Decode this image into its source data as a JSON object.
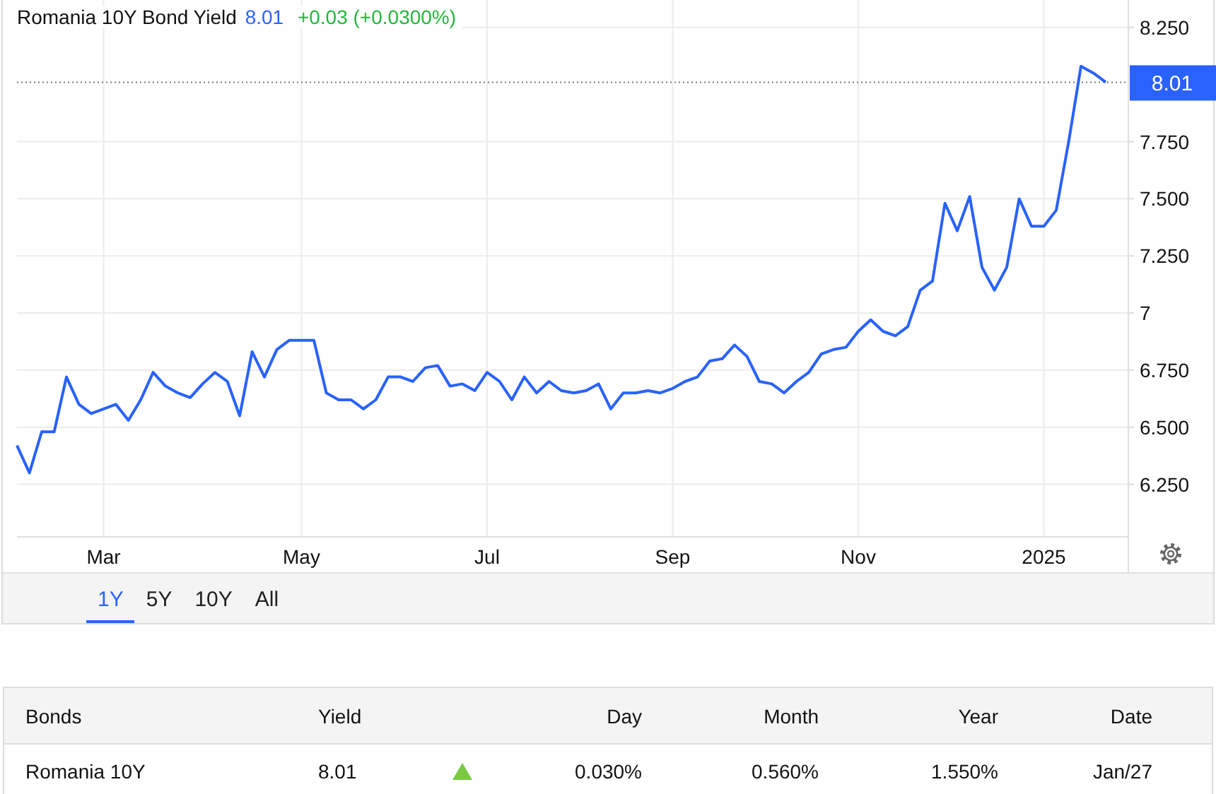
{
  "header": {
    "price": "8.01",
    "change": "+0.03 (+0.0300%)"
  },
  "chart": {
    "chart_data": {
      "type": "line",
      "categories": [
        null,
        null,
        null,
        null,
        null,
        null,
        null,
        "Mar",
        null,
        null,
        null,
        null,
        null,
        null,
        null,
        null,
        null,
        null,
        null,
        null,
        null,
        null,
        null,
        "May",
        null,
        null,
        null,
        null,
        null,
        null,
        null,
        null,
        null,
        null,
        null,
        null,
        null,
        null,
        "Jul",
        null,
        null,
        null,
        null,
        null,
        null,
        null,
        null,
        null,
        null,
        null,
        null,
        null,
        null,
        "Sep",
        null,
        null,
        null,
        null,
        null,
        null,
        null,
        null,
        null,
        null,
        null,
        null,
        null,
        null,
        "Nov",
        null,
        null,
        null,
        null,
        null,
        null,
        null,
        null,
        null,
        null,
        null,
        null,
        null,
        null,
        "2025",
        null,
        null,
        null,
        null,
        null
      ],
      "series": [
        {
          "name": "Romania 10Y Bond Yield",
          "color": "#2962ff",
          "values": [
            6.42,
            6.3,
            6.48,
            6.48,
            6.72,
            6.6,
            6.56,
            6.58,
            6.6,
            6.53,
            6.62,
            6.74,
            6.68,
            6.65,
            6.63,
            6.69,
            6.74,
            6.7,
            6.55,
            6.83,
            6.72,
            6.84,
            6.88,
            6.88,
            6.88,
            6.65,
            6.62,
            6.62,
            6.58,
            6.62,
            6.72,
            6.72,
            6.7,
            6.76,
            6.77,
            6.68,
            6.69,
            6.66,
            6.74,
            6.7,
            6.62,
            6.72,
            6.65,
            6.7,
            6.66,
            6.65,
            6.66,
            6.69,
            6.58,
            6.65,
            6.65,
            6.66,
            6.65,
            6.67,
            6.7,
            6.72,
            6.79,
            6.8,
            6.86,
            6.81,
            6.7,
            6.69,
            6.65,
            6.7,
            6.74,
            6.82,
            6.84,
            6.85,
            6.92,
            6.97,
            6.92,
            6.9,
            6.94,
            7.1,
            7.14,
            7.48,
            7.36,
            7.51,
            7.2,
            7.1,
            7.2,
            7.5,
            7.38,
            7.38,
            7.45,
            7.75,
            8.08,
            8.05,
            8.01
          ]
        }
      ],
      "ylim": [
        6.02,
        8.37
      ],
      "grid": true,
      "ref_lines": [
        {
          "axis": "y",
          "value": 8.01,
          "label": "8.01"
        }
      ],
      "yticks": [
        {
          "value": 8.25,
          "label": "8.250"
        },
        {
          "value": 7.75,
          "label": "7.750"
        },
        {
          "value": 7.5,
          "label": "7.500"
        },
        {
          "value": 7.25,
          "label": "7.250"
        },
        {
          "value": 7,
          "label": "7"
        },
        {
          "value": 6.75,
          "label": "6.750"
        },
        {
          "value": 6.5,
          "label": "6.500"
        },
        {
          "value": 6.25,
          "label": "6.250"
        }
      ]
    }
  },
  "ranges": [
    {
      "label": "1Y",
      "selected": true
    },
    {
      "label": "5Y",
      "selected": false
    },
    {
      "label": "10Y",
      "selected": false
    },
    {
      "label": "All",
      "selected": false
    }
  ],
  "table": {
    "columns": [
      "Bonds",
      "Yield",
      "Day",
      "Month",
      "Year",
      "Date"
    ],
    "rows": [
      {
        "bond": "Romania 10Y",
        "yield": "8.01",
        "kind": "up",
        "day": "0.030%",
        "month": "0.560%",
        "year": "1.550%",
        "date": "Jan/27"
      }
    ]
  }
}
